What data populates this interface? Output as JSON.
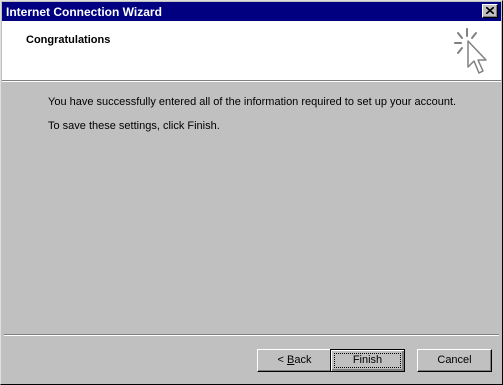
{
  "window": {
    "title": "Internet Connection Wizard",
    "close_icon": "close-icon"
  },
  "header": {
    "title": "Congratulations",
    "icon": "wizard-sparkle-cursor-icon"
  },
  "body": {
    "line1": "You have successfully entered all of the information required to set up your account.",
    "line2": "To save these settings, click Finish."
  },
  "buttons": {
    "back_prefix": "< ",
    "back_mnemonic": "B",
    "back_rest": "ack",
    "finish": "Finish",
    "cancel": "Cancel"
  },
  "colors": {
    "titlebar": "#000080",
    "dialog_bg": "#c0c0c0",
    "header_bg": "#ffffff"
  }
}
